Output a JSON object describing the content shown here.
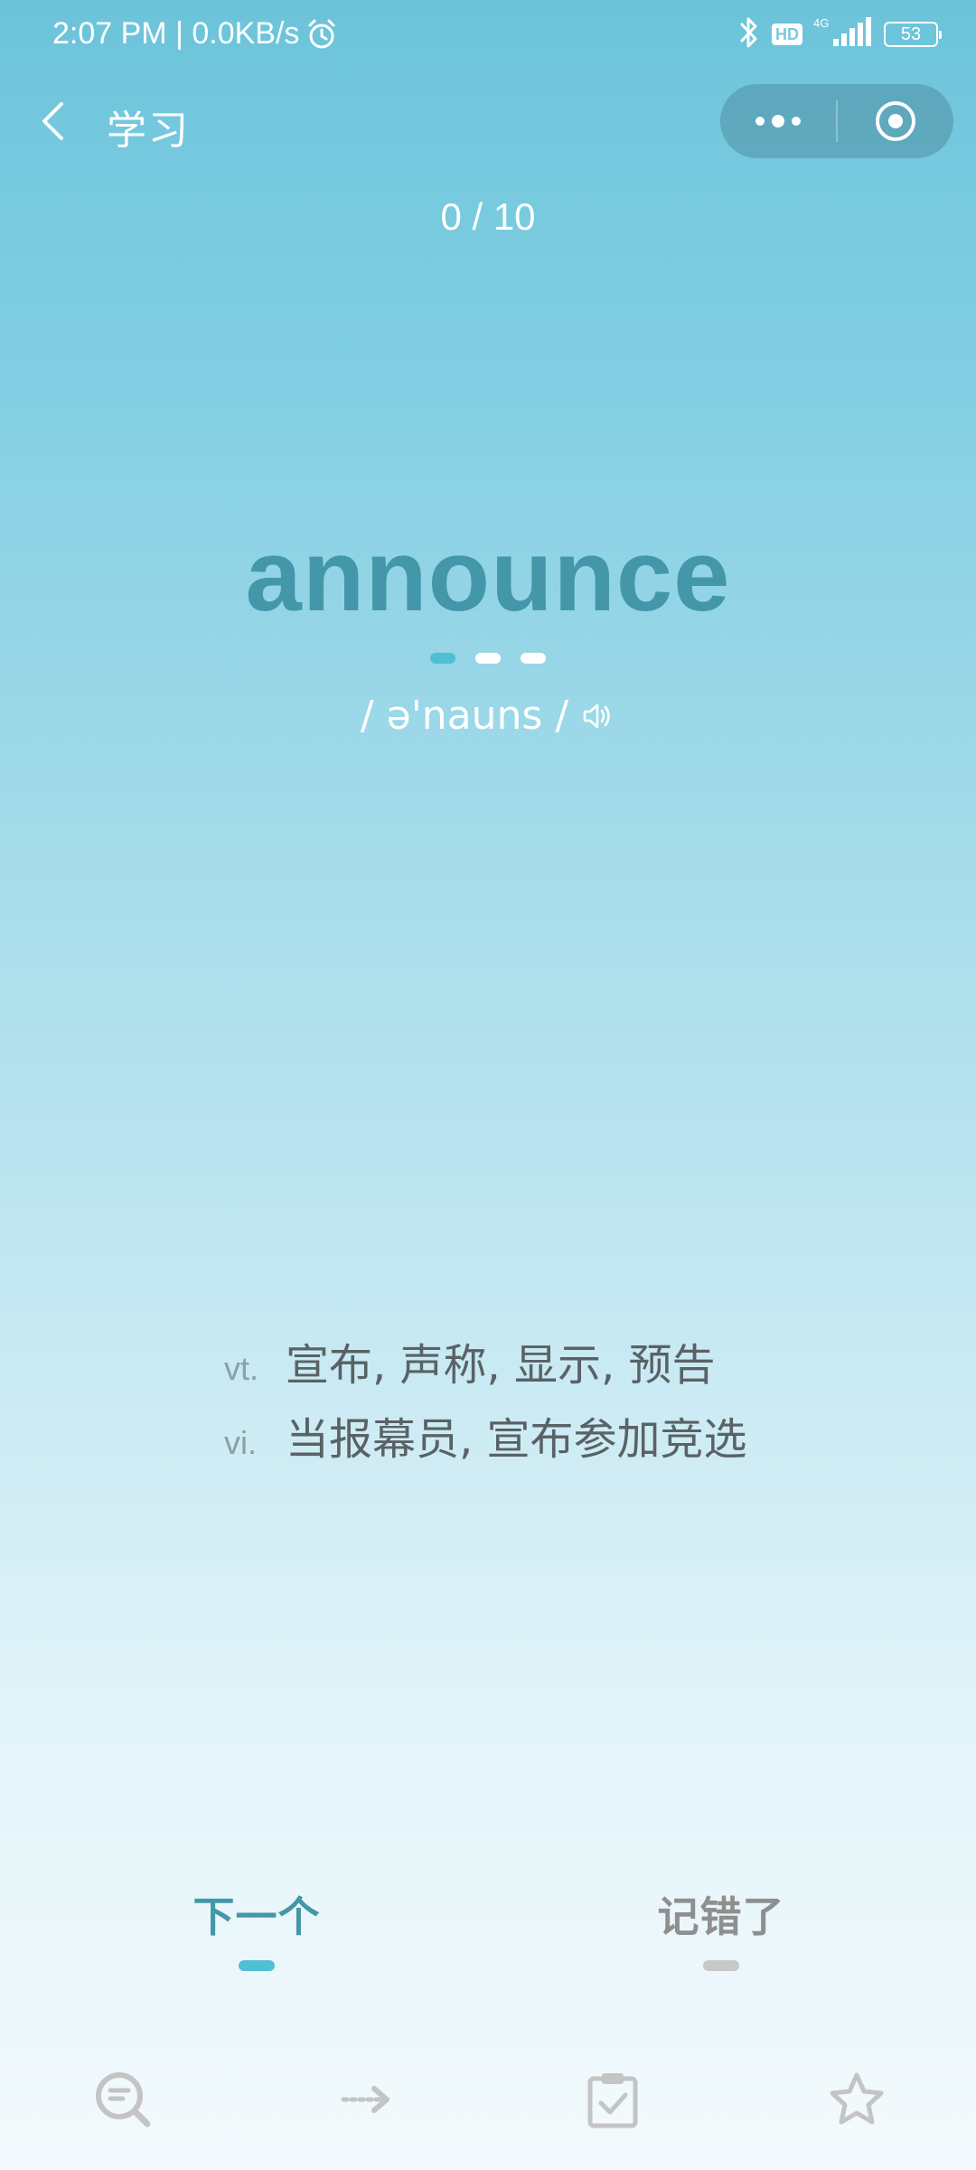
{
  "status_bar": {
    "time": "2:07 PM | 0.0KB/s",
    "network_badge": "HD",
    "network_type": "4G",
    "battery": "53",
    "icons": [
      "alarm-icon",
      "bluetooth-icon",
      "signal-icon",
      "battery-icon"
    ]
  },
  "nav": {
    "title": "学习"
  },
  "progress": {
    "text": "0 / 10",
    "current": 0,
    "total": 10
  },
  "word": {
    "text": "announce",
    "phonetic": "/ ə'nauns /"
  },
  "page_dots": {
    "count": 3,
    "active_index": 0
  },
  "definitions": [
    {
      "pos": "vt.",
      "meaning": "宣布, 声称, 显示, 预告"
    },
    {
      "pos": "vi.",
      "meaning": "当报幕员, 宣布参加竞选"
    }
  ],
  "actions": {
    "next_label": "下一个",
    "wrong_label": "记错了"
  },
  "toolbar": {
    "icons": [
      "search-list-icon",
      "arrow-right-icon",
      "clipboard-check-icon",
      "star-icon"
    ]
  },
  "colors": {
    "background_top": "#6cc4da",
    "background_bottom": "#f3fafd",
    "word": "#4497a8",
    "accent": "#4fbfd6",
    "muted": "#8f8f8f",
    "definition_text": "#5a6266"
  }
}
